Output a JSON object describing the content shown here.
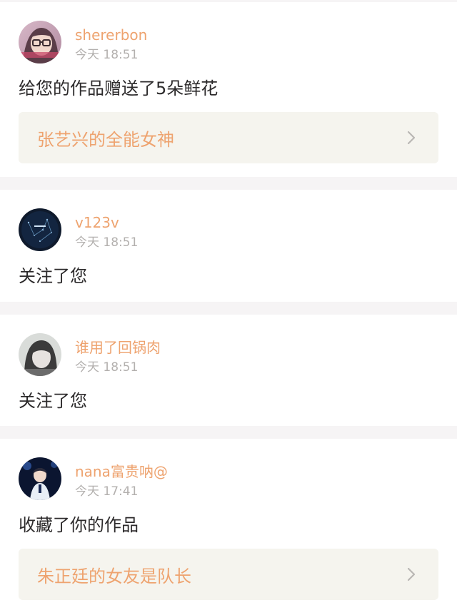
{
  "notifications": [
    {
      "username": "shererbon",
      "time": "今天 18:51",
      "action": "给您的作品赠送了5朵鲜花",
      "work_title": "张艺兴的全能女神",
      "avatar_icon": "avatar-girl-glasses-icon"
    },
    {
      "username": "v123v",
      "time": "今天 18:51",
      "action": "关注了您",
      "avatar_icon": "avatar-night-sky-icon"
    },
    {
      "username": "谁用了回锅肉",
      "time": "今天 18:51",
      "action": "关注了您",
      "avatar_icon": "avatar-short-hair-girl-icon"
    },
    {
      "username": "nana富贵呐@",
      "time": "今天 17:41",
      "action": "收藏了你的作品",
      "work_title": "朱正廷的女友是队长",
      "avatar_icon": "avatar-singer-icon"
    }
  ],
  "colors": {
    "accent": "#eea36f",
    "time_text": "#b3b0ae",
    "body_text": "#2c2a2b",
    "card_bg": "#ffffff",
    "page_bg": "#f6f4f5",
    "link_bg": "#f5f4ee"
  }
}
